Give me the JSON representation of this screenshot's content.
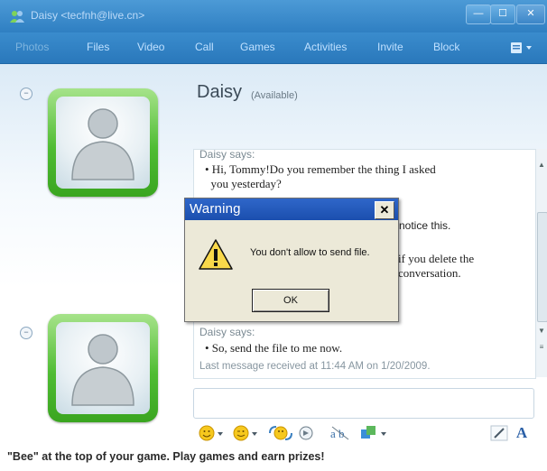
{
  "window": {
    "title": "Daisy <tecfnh@live.cn>",
    "controls": {
      "minimize": "—",
      "maximize": "☐",
      "close": "✕"
    }
  },
  "menu": {
    "items": [
      {
        "label": "Photos"
      },
      {
        "label": "Files"
      },
      {
        "label": "Video"
      },
      {
        "label": "Call"
      },
      {
        "label": "Games"
      },
      {
        "label": "Activities"
      },
      {
        "label": "Invite"
      },
      {
        "label": "Block"
      }
    ],
    "extra_icon": "options-icon"
  },
  "contact": {
    "name": "Daisy",
    "status": "(Available)"
  },
  "conversation": {
    "messages": [
      {
        "sender": "Daisy says:",
        "text": "• Hi, Tommy!Do you remember the thing I asked\n  you yesterday?"
      },
      {
        "partial": "notice this."
      },
      {
        "partial_lines": "if you delete the\nconversation."
      },
      {
        "sender": "Daisy says:",
        "text": "• So, send the file to me now."
      }
    ],
    "last_message": "Last message received at 11:44 AM on 1/20/2009."
  },
  "dialog": {
    "title": "Warning",
    "close_label": "✕",
    "message": "You don't allow to send file.",
    "ok_label": "OK",
    "icon": "warning-icon"
  },
  "toolbar": {
    "icons": [
      "emoticon-icon",
      "wink-icon",
      "voice-clip-icon",
      "nudge-icon",
      "font-icon",
      "background-icon",
      "handwriting-icon",
      "text-style-icon"
    ],
    "text_style_label": "A"
  },
  "promo": "\"Bee\" at the top of your game. Play games and earn prizes!",
  "colors": {
    "title_bar": "#2f7fc2",
    "menu_bar": "#2a78bb",
    "avatar_green": "#4fbc33",
    "dialog_title": "#1b4fae",
    "dialog_face": "#ece9d8"
  }
}
